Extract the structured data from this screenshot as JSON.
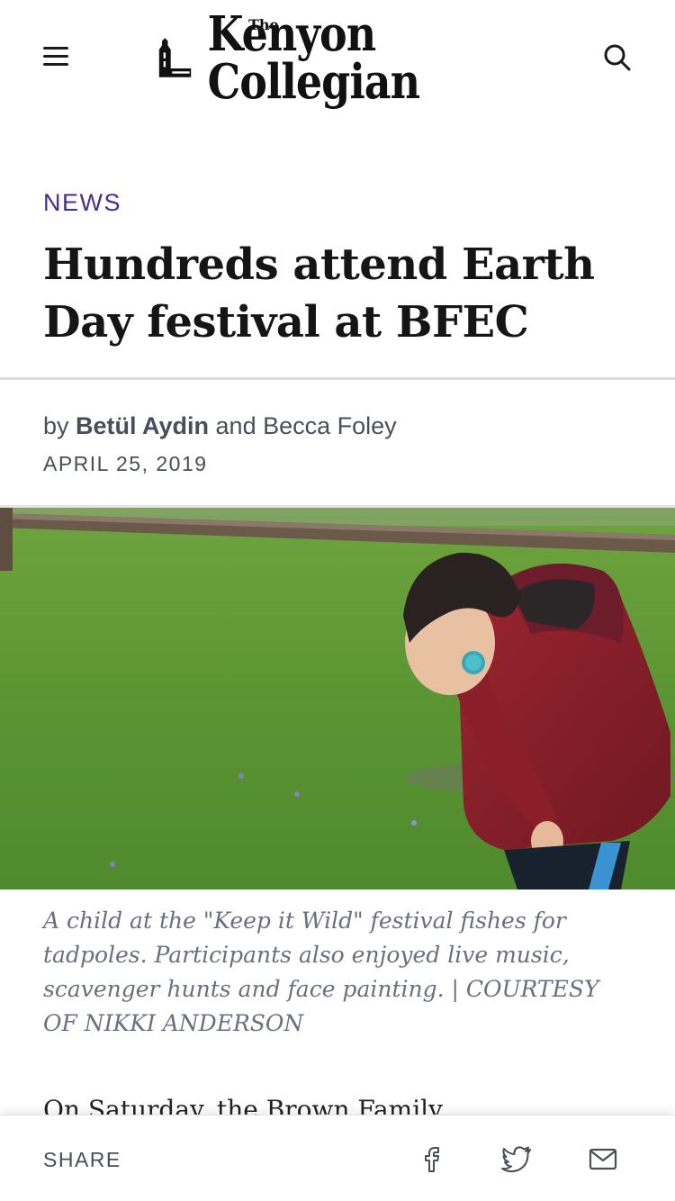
{
  "header": {
    "logo_small": "The",
    "logo_text": "Kenyon Collegian"
  },
  "article": {
    "section": "NEWS",
    "headline": "Hundreds attend Earth Day festival at BFEC",
    "byline_prefix": "by ",
    "author_primary": "Betül Aydin",
    "byline_joiner": " and ",
    "author_secondary": "Becca Foley",
    "date": "APRIL 25, 2019",
    "caption": "A child at the \"Keep it Wild\" festival fishes for tadpoles. Participants also enjoyed live music, scavenger hunts and face painting. | COURTESY OF NIKKI ANDERSON",
    "body_first_line": "On Saturday, the Brown Family"
  },
  "share": {
    "label": "SHARE",
    "icons": [
      "facebook-icon",
      "twitter-icon",
      "mail-icon"
    ]
  },
  "colors": {
    "section_accent": "#4b2c8c",
    "meta_text": "#4a4d5a",
    "caption_text": "#6b6e80"
  }
}
